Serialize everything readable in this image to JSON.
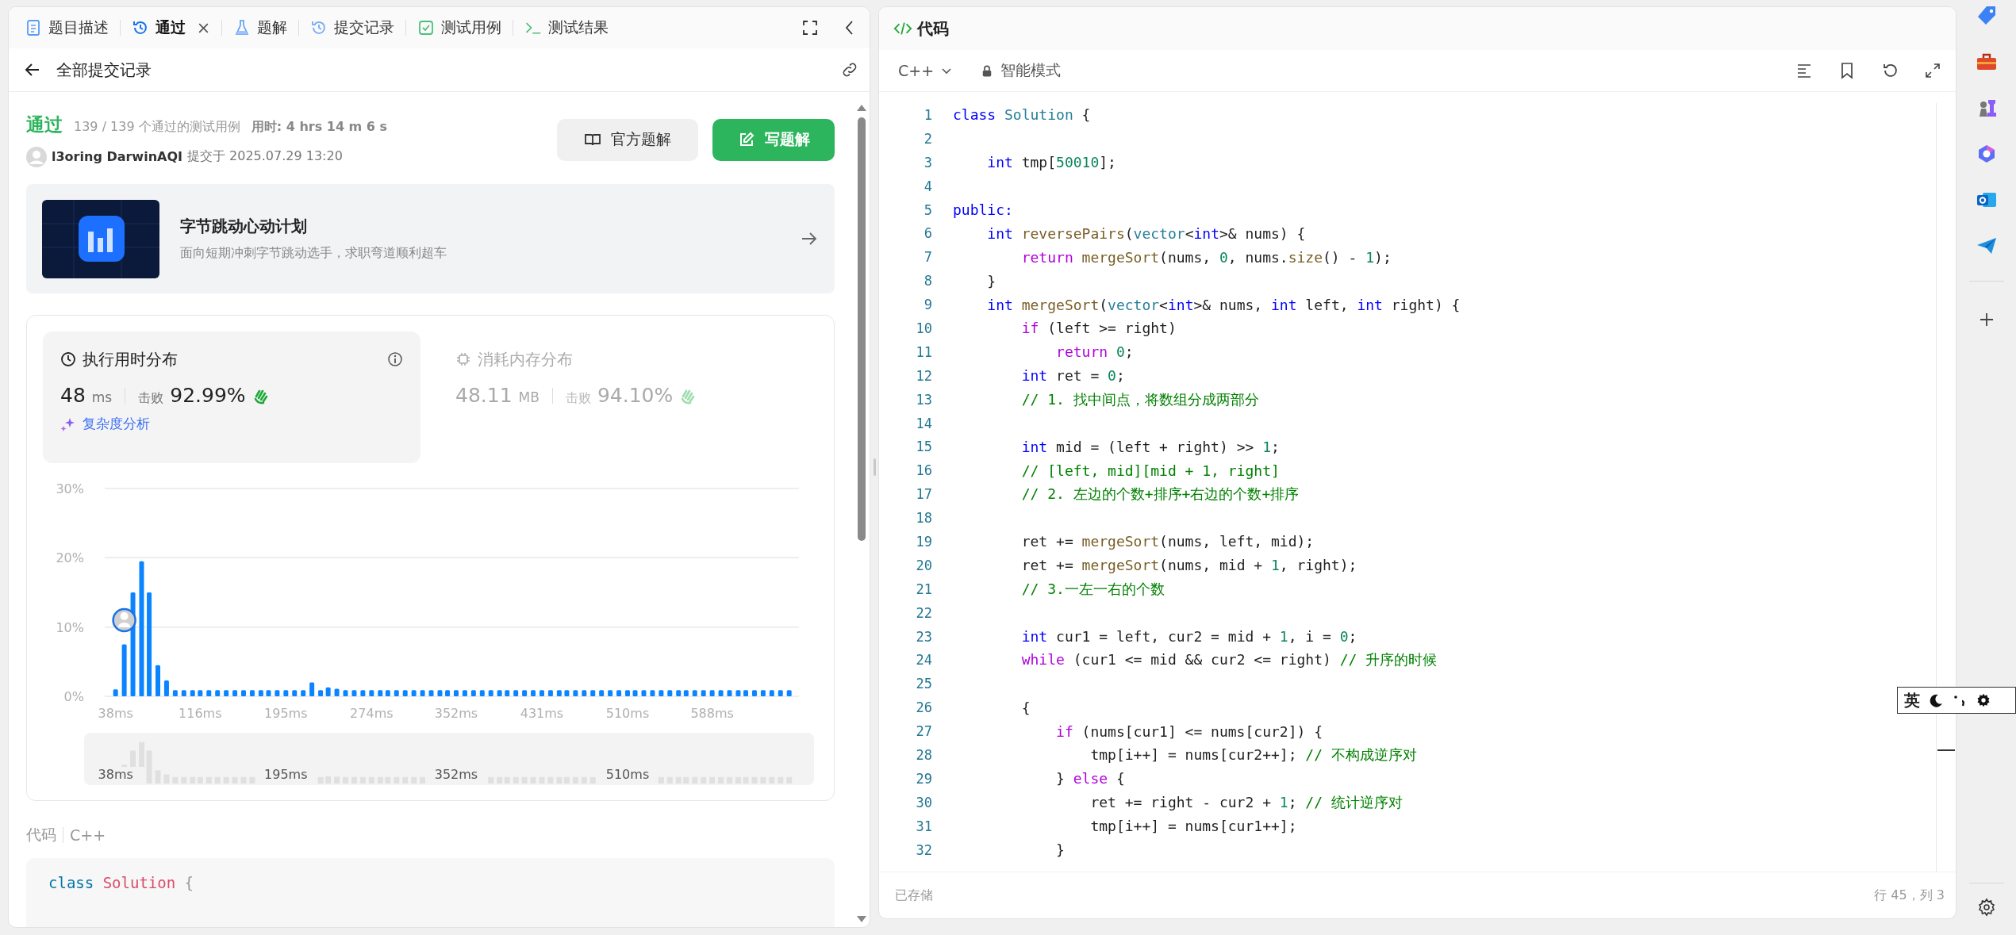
{
  "tabs": [
    {
      "label": "题目描述",
      "kind": "doc",
      "selected": false,
      "closable": false
    },
    {
      "label": "通过",
      "kind": "history",
      "selected": true,
      "closable": true
    },
    {
      "label": "题解",
      "kind": "flask",
      "selected": false,
      "closable": false
    },
    {
      "label": "提交记录",
      "kind": "history",
      "selected": false,
      "closable": false
    },
    {
      "label": "测试用例",
      "kind": "check",
      "selected": false,
      "closable": false
    },
    {
      "label": "测试结果",
      "kind": "terminal",
      "selected": false,
      "closable": false
    }
  ],
  "header": {
    "title": "全部提交记录"
  },
  "result": {
    "status": "通过",
    "cases": "139 / 139 个通过的测试用例",
    "duration": "用时: 4 hrs 14 m 6 s",
    "user": "l3oring DarwinAQI",
    "submitted": "提交于 2025.07.29 13:20",
    "buttons": [
      {
        "label": "官方题解",
        "kind": "secondary"
      },
      {
        "label": "写题解",
        "kind": "primary"
      }
    ]
  },
  "promo": {
    "title": "字节跳动心动计划",
    "subtitle": "面向短期冲刺字节跳动选手，求职弯道顺利超车"
  },
  "stats": [
    {
      "kind": "time",
      "title": "执行用时分布",
      "value": "48",
      "unit": "ms",
      "beat_label": "击败",
      "beat": "92.99%",
      "selected": true
    },
    {
      "kind": "memory",
      "title": "消耗内存分布",
      "value": "48.11",
      "unit": "MB",
      "beat_label": "击败",
      "beat": "94.10%",
      "selected": false
    }
  ],
  "analysis_link": "复杂度分析",
  "chart": {
    "chart_data": {
      "type": "bar",
      "xlim": [
        28,
        668
      ],
      "ylim": [
        0,
        30
      ],
      "yticks": [
        {
          "value": 0,
          "label": "0%"
        },
        {
          "value": 10,
          "label": "10%"
        },
        {
          "value": 20,
          "label": "20%"
        },
        {
          "value": 30,
          "label": "30%"
        }
      ],
      "xticks": [
        {
          "value": 38,
          "label": "38ms"
        },
        {
          "value": 116,
          "label": "116ms"
        },
        {
          "value": 195,
          "label": "195ms"
        },
        {
          "value": 274,
          "label": "274ms"
        },
        {
          "value": 352,
          "label": "352ms"
        },
        {
          "value": 431,
          "label": "431ms"
        },
        {
          "value": 510,
          "label": "510ms"
        },
        {
          "value": 588,
          "label": "588ms"
        }
      ],
      "x": [
        38,
        46,
        54,
        62,
        69,
        77,
        85,
        93,
        101,
        109,
        116,
        124,
        132,
        140,
        148,
        156,
        164,
        172,
        179,
        187,
        195,
        203,
        211,
        219,
        227,
        234,
        242,
        250,
        258,
        266,
        274,
        282,
        289,
        297,
        305,
        313,
        321,
        329,
        337,
        344,
        352,
        360,
        368,
        376,
        384,
        392,
        399,
        407,
        415,
        423,
        431,
        439,
        447,
        454,
        462,
        470,
        478,
        486,
        494,
        502,
        510,
        517,
        525,
        533,
        541,
        549,
        557,
        564,
        572,
        580,
        588,
        596,
        604,
        612,
        619,
        627,
        635,
        643,
        651,
        659
      ],
      "values": [
        1.0,
        7.5,
        15.0,
        19.5,
        15.0,
        4.5,
        2.3,
        0.9,
        0.9,
        0.9,
        0.9,
        0.9,
        0.9,
        0.9,
        0.9,
        0.9,
        0.9,
        0.9,
        0.9,
        0.9,
        0.9,
        0.9,
        0.9,
        2.0,
        0.9,
        1.3,
        1.1,
        0.9,
        0.9,
        0.9,
        0.9,
        0.9,
        0.9,
        0.9,
        0.9,
        0.9,
        0.9,
        0.9,
        0.9,
        0.9,
        0.9,
        0.9,
        0.9,
        0.9,
        0.9,
        0.9,
        0.9,
        0.9,
        0.9,
        0.9,
        0.9,
        0.9,
        0.9,
        0.9,
        0.9,
        0.9,
        0.9,
        0.9,
        0.9,
        0.9,
        0.9,
        0.9,
        0.9,
        0.9,
        0.9,
        0.9,
        0.9,
        0.9,
        0.9,
        0.9,
        0.9,
        0.9,
        0.9,
        0.9,
        0.9,
        0.9,
        0.9,
        0.9,
        0.9,
        0.9
      ]
    },
    "overview_labels": [
      "38ms",
      "195ms",
      "352ms",
      "510ms"
    ]
  },
  "code_preview": {
    "title": "代码",
    "language": "C++",
    "tokens": [
      {
        "kind": "kw",
        "text": "class"
      },
      {
        "kind": "type",
        "text": " Solution"
      },
      {
        "kind": "plain",
        "text": " {"
      }
    ]
  },
  "editor": {
    "title": "代码",
    "language": "C++",
    "mode": "智能模式",
    "lines": [
      {
        "number": "1",
        "tokens": [
          {
            "kind": "kw",
            "text": "class"
          },
          {
            "kind": "type",
            "text": " Solution"
          },
          {
            "kind": "plain",
            "text": " {"
          }
        ]
      },
      {
        "number": "2"
      },
      {
        "number": "3",
        "tokens": [
          {
            "kind": "kw",
            "text": "    int"
          },
          {
            "kind": "plain",
            "text": " tmp["
          },
          {
            "kind": "num",
            "text": "50010"
          },
          {
            "kind": "plain",
            "text": "];"
          }
        ]
      },
      {
        "number": "4"
      },
      {
        "number": "5",
        "tokens": [
          {
            "kind": "kw",
            "text": "public:"
          }
        ]
      },
      {
        "number": "6",
        "tokens": [
          {
            "kind": "kw",
            "text": "    int"
          },
          {
            "kind": "fn",
            "text": " reversePairs"
          },
          {
            "kind": "plain",
            "text": "("
          },
          {
            "kind": "type",
            "text": "vector"
          },
          {
            "kind": "plain",
            "text": "<"
          },
          {
            "kind": "kw",
            "text": "int"
          },
          {
            "kind": "plain",
            "text": ">& nums) {"
          }
        ]
      },
      {
        "number": "7",
        "tokens": [
          {
            "kind": "ctl",
            "text": "        return"
          },
          {
            "kind": "fn",
            "text": " mergeSort"
          },
          {
            "kind": "plain",
            "text": "(nums, "
          },
          {
            "kind": "num",
            "text": "0"
          },
          {
            "kind": "plain",
            "text": ", nums."
          },
          {
            "kind": "fn",
            "text": "size"
          },
          {
            "kind": "plain",
            "text": "() - "
          },
          {
            "kind": "num",
            "text": "1"
          },
          {
            "kind": "plain",
            "text": ");"
          }
        ]
      },
      {
        "number": "8",
        "tokens": [
          {
            "kind": "plain",
            "text": "    }"
          }
        ]
      },
      {
        "number": "9",
        "tokens": [
          {
            "kind": "kw",
            "text": "    int"
          },
          {
            "kind": "fn",
            "text": " mergeSort"
          },
          {
            "kind": "plain",
            "text": "("
          },
          {
            "kind": "type",
            "text": "vector"
          },
          {
            "kind": "plain",
            "text": "<"
          },
          {
            "kind": "kw",
            "text": "int"
          },
          {
            "kind": "plain",
            "text": ">& nums, "
          },
          {
            "kind": "kw",
            "text": "int"
          },
          {
            "kind": "plain",
            "text": " left, "
          },
          {
            "kind": "kw",
            "text": "int"
          },
          {
            "kind": "plain",
            "text": " right) {"
          }
        ]
      },
      {
        "number": "10",
        "tokens": [
          {
            "kind": "ctl",
            "text": "        if"
          },
          {
            "kind": "plain",
            "text": " (left >= right)"
          }
        ]
      },
      {
        "number": "11",
        "tokens": [
          {
            "kind": "ctl",
            "text": "            return"
          },
          {
            "kind": "num",
            "text": " 0"
          },
          {
            "kind": "plain",
            "text": ";"
          }
        ]
      },
      {
        "number": "12",
        "tokens": [
          {
            "kind": "kw",
            "text": "        int"
          },
          {
            "kind": "plain",
            "text": " ret = "
          },
          {
            "kind": "num",
            "text": "0"
          },
          {
            "kind": "plain",
            "text": ";"
          }
        ]
      },
      {
        "number": "13",
        "tokens": [
          {
            "kind": "cm",
            "text": "        // 1. 找中间点，将数组分成两部分"
          }
        ]
      },
      {
        "number": "14"
      },
      {
        "number": "15",
        "tokens": [
          {
            "kind": "kw",
            "text": "        int"
          },
          {
            "kind": "plain",
            "text": " mid = (left + right) >> "
          },
          {
            "kind": "num",
            "text": "1"
          },
          {
            "kind": "plain",
            "text": ";"
          }
        ]
      },
      {
        "number": "16",
        "tokens": [
          {
            "kind": "cm",
            "text": "        // [left, mid][mid + 1, right]"
          }
        ]
      },
      {
        "number": "17",
        "tokens": [
          {
            "kind": "cm",
            "text": "        // 2. 左边的个数+排序+右边的个数+排序"
          }
        ]
      },
      {
        "number": "18"
      },
      {
        "number": "19",
        "tokens": [
          {
            "kind": "plain",
            "text": "        ret += "
          },
          {
            "kind": "fn",
            "text": "mergeSort"
          },
          {
            "kind": "plain",
            "text": "(nums, left, mid);"
          }
        ]
      },
      {
        "number": "20",
        "tokens": [
          {
            "kind": "plain",
            "text": "        ret += "
          },
          {
            "kind": "fn",
            "text": "mergeSort"
          },
          {
            "kind": "plain",
            "text": "(nums, mid + "
          },
          {
            "kind": "num",
            "text": "1"
          },
          {
            "kind": "plain",
            "text": ", right);"
          }
        ]
      },
      {
        "number": "21",
        "tokens": [
          {
            "kind": "cm",
            "text": "        // 3.一左一右的个数"
          }
        ]
      },
      {
        "number": "22"
      },
      {
        "number": "23",
        "tokens": [
          {
            "kind": "kw",
            "text": "        int"
          },
          {
            "kind": "plain",
            "text": " cur1 = left, cur2 = mid + "
          },
          {
            "kind": "num",
            "text": "1"
          },
          {
            "kind": "plain",
            "text": ", i = "
          },
          {
            "kind": "num",
            "text": "0"
          },
          {
            "kind": "plain",
            "text": ";"
          }
        ]
      },
      {
        "number": "24",
        "tokens": [
          {
            "kind": "ctl",
            "text": "        while"
          },
          {
            "kind": "plain",
            "text": " (cur1 <= mid && cur2 <= right)"
          },
          {
            "kind": "cm",
            "text": " // 升序的时候"
          }
        ]
      },
      {
        "number": "25"
      },
      {
        "number": "26",
        "tokens": [
          {
            "kind": "plain",
            "text": "        {"
          }
        ]
      },
      {
        "number": "27",
        "tokens": [
          {
            "kind": "ctl",
            "text": "            if"
          },
          {
            "kind": "plain",
            "text": " (nums[cur1] <= nums[cur2]) {"
          }
        ]
      },
      {
        "number": "28",
        "tokens": [
          {
            "kind": "plain",
            "text": "                tmp[i++] = nums[cur2++];"
          },
          {
            "kind": "cm",
            "text": " // 不构成逆序对"
          }
        ]
      },
      {
        "number": "29",
        "tokens": [
          {
            "kind": "plain",
            "text": "            }"
          },
          {
            "kind": "ctl",
            "text": " else"
          },
          {
            "kind": "plain",
            "text": " {"
          }
        ]
      },
      {
        "number": "30",
        "tokens": [
          {
            "kind": "plain",
            "text": "                ret += right - cur2 + "
          },
          {
            "kind": "num",
            "text": "1"
          },
          {
            "kind": "plain",
            "text": ";"
          },
          {
            "kind": "cm",
            "text": " // 统计逆序对"
          }
        ]
      },
      {
        "number": "31",
        "tokens": [
          {
            "kind": "plain",
            "text": "                tmp[i++] = nums[cur1++];"
          }
        ]
      },
      {
        "number": "32",
        "tokens": [
          {
            "kind": "plain",
            "text": "            }"
          }
        ]
      }
    ],
    "status": "已存储",
    "position": "行 45，列 3"
  },
  "ime": {
    "label": "英"
  }
}
